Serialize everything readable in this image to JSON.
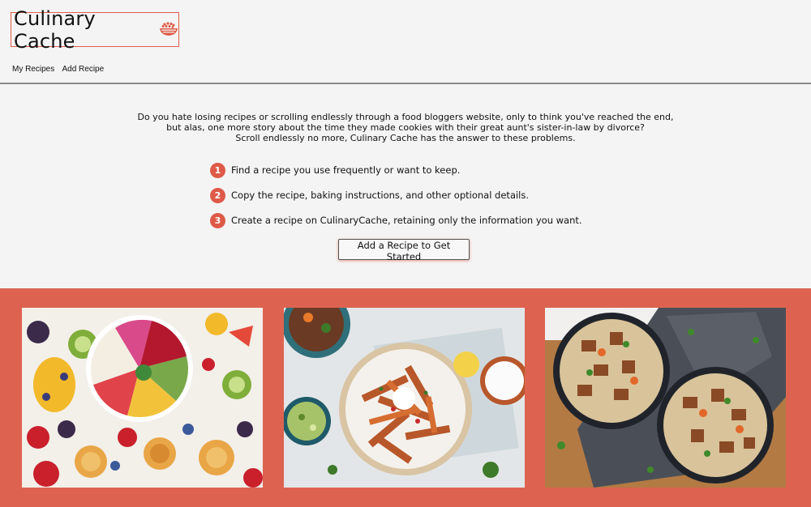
{
  "header": {
    "brand": "Culinary Cache",
    "logo_icon": "bowl-icon"
  },
  "nav": {
    "my_recipes": "My Recipes",
    "add_recipe": "Add Recipe"
  },
  "intro": {
    "line1": "Do you hate losing recipes or scrolling endlessly through a food bloggers website, only to think you've reached the end,",
    "line2": "but alas, one more story about the time they made cookies with their great aunt's sister-in-law by divorce?",
    "line3": "Scroll endlessly no more, Culinary Cache has the answer to these problems."
  },
  "steps": [
    {
      "num": "1",
      "text": "Find a recipe you use frequently or want to keep."
    },
    {
      "num": "2",
      "text": "Copy the recipe, baking instructions, and other optional details."
    },
    {
      "num": "3",
      "text": "Create a recipe on CulinaryCache, retaining only the information you want."
    }
  ],
  "cta": {
    "label": "Add a Recipe to Get Started"
  },
  "colors": {
    "accent": "#de5a48",
    "band": "#dd6350",
    "background": "#f4f4f4"
  },
  "gallery": [
    "fruit-bowl-photo",
    "sweet-potato-fries-photo",
    "noodle-bowls-photo"
  ]
}
